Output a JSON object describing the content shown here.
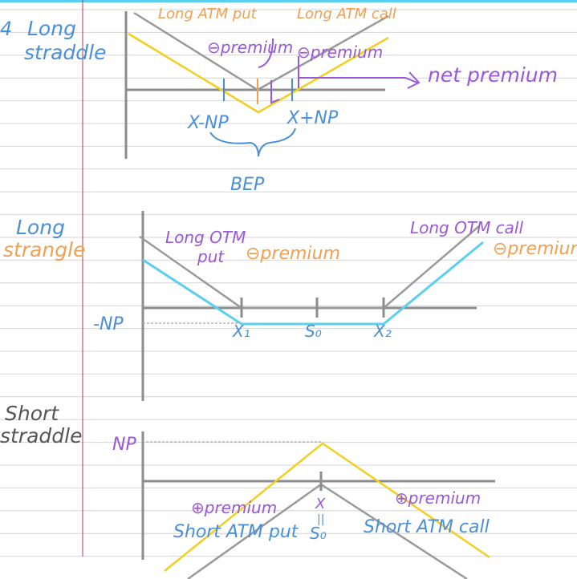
{
  "colors": {
    "paper": "#ffffff",
    "rule_line": "#d4d4d4",
    "margin_line": "#b03a48",
    "top_bar": "#5ad0f0",
    "axis": "#8c8c8c",
    "payoff_gray": "#9a9a9a",
    "payoff_yellow": "#f2cf1f",
    "payoff_cyan": "#5bcff0",
    "ink_blue": "#4a90d9",
    "ink_orange": "#f0a050",
    "ink_purple": "#9a58d8",
    "dash": "#b4b4b4"
  },
  "sections": {
    "long_straddle": {
      "number": "4",
      "title_line1": "Long",
      "title_line2": "straddle",
      "long_put_label": "Long ATM put",
      "long_call_label": "Long ATM call",
      "put_premium": "⊖premium",
      "call_premium": "⊖premium",
      "net_premium": "net premium",
      "lower_bep": "X-NP",
      "upper_bep": "X+NP",
      "bep": "BEP"
    },
    "long_strangle": {
      "title_line1": "Long",
      "title_line2": "strangle",
      "put_label_line1": "Long OTM",
      "put_label_line2": "put",
      "put_premium": "⊖premium",
      "call_label": "Long OTM call",
      "call_premium": "⊖premium",
      "neg_np": "-NP",
      "x1": "X₁",
      "s0": "S₀",
      "x2": "X₂"
    },
    "short_straddle": {
      "title_line1": "Short",
      "title_line2": "straddle",
      "np": "NP",
      "put_premium": "⊕premium",
      "put_label": "Short ATM put",
      "call_premium": "⊕premium",
      "call_label": "Short ATM call",
      "x": "X",
      "eq": "||",
      "s0": "S₀"
    }
  }
}
